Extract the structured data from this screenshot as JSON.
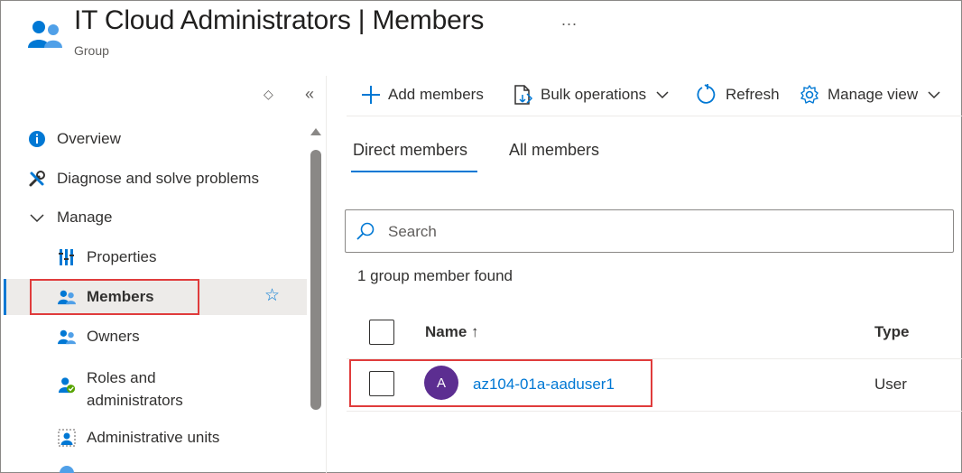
{
  "header": {
    "title_main": "IT Cloud Administrators",
    "title_sep": "|",
    "title_page": "Members",
    "subtitle": "Group",
    "more_icon": "more-ellipsis-icon",
    "more_glyph": "..."
  },
  "nav_controls": {
    "updown_glyph": "◇",
    "collapse_glyph": "«"
  },
  "nav": {
    "items": [
      {
        "label": "Overview",
        "icon": "info-icon"
      },
      {
        "label": "Diagnose and solve problems",
        "icon": "wrench-icon"
      },
      {
        "label": "Manage",
        "icon": "chevron-down-icon"
      },
      {
        "label": "Properties",
        "icon": "properties-icon"
      },
      {
        "label": "Members",
        "icon": "members-icon",
        "selected": true
      },
      {
        "label": "Owners",
        "icon": "owners-icon"
      },
      {
        "label": "Roles and",
        "label2": "administrators",
        "icon": "roles-icon"
      },
      {
        "label": "Administrative units",
        "icon": "admin-units-icon"
      }
    ],
    "favorite_glyph": "☆"
  },
  "toolbar": {
    "add_members": "Add members",
    "bulk_operations": "Bulk operations",
    "refresh": "Refresh",
    "manage_view": "Manage view"
  },
  "tabs": {
    "direct": "Direct members",
    "all": "All members"
  },
  "search": {
    "placeholder": "Search",
    "value": ""
  },
  "results": {
    "count_text": "1 group member found"
  },
  "table": {
    "columns": {
      "name": "Name ↑",
      "type": "Type"
    },
    "rows": [
      {
        "avatar_initial": "A",
        "name": "az104-01a-aaduser1",
        "type": "User"
      }
    ]
  },
  "colors": {
    "accent": "#0078d4",
    "highlight_box": "#e03c3c",
    "avatar_bg": "#5c2e91"
  }
}
